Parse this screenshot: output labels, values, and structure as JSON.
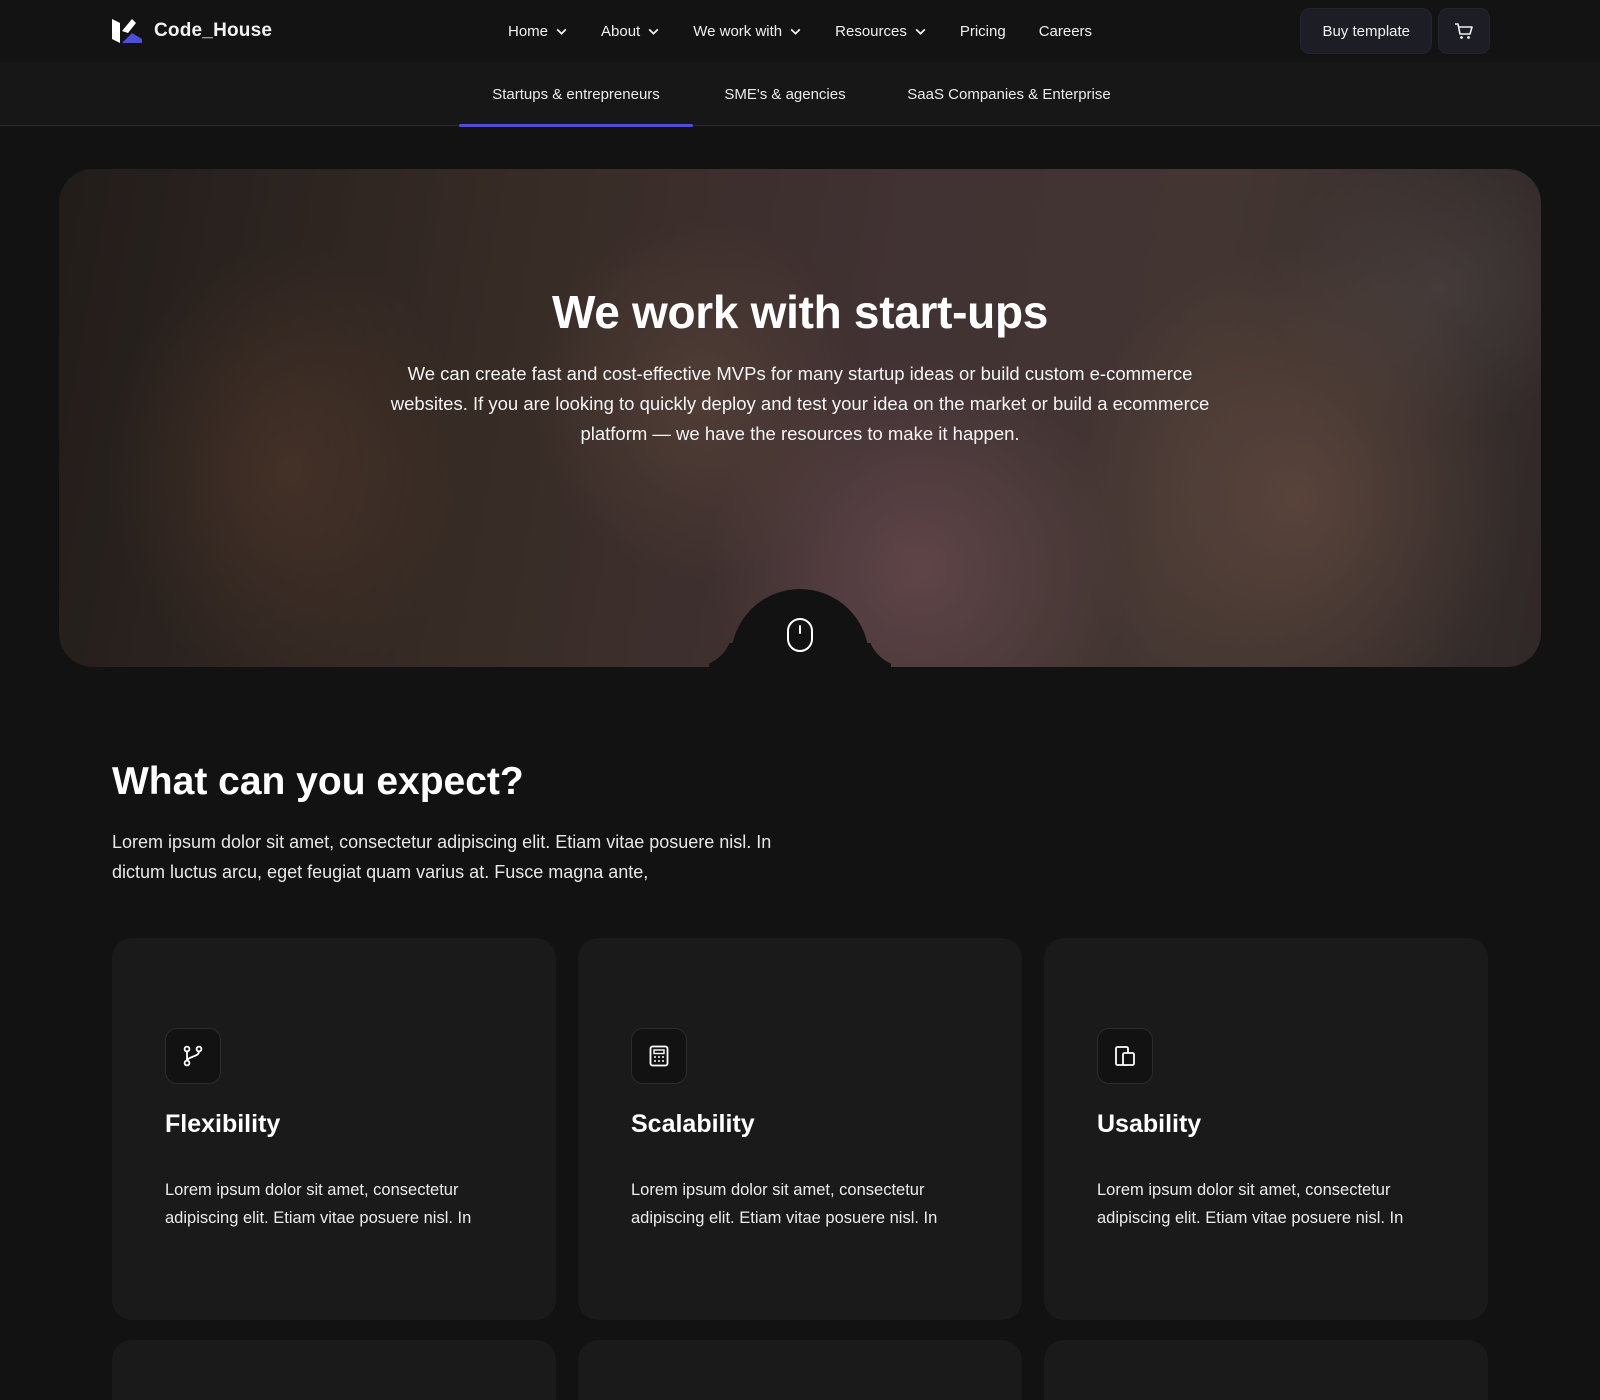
{
  "brand": {
    "name": "Code_House",
    "accent": "#4b4fd9"
  },
  "nav": {
    "items": [
      {
        "label": "Home",
        "has_dropdown": true
      },
      {
        "label": "About",
        "has_dropdown": true
      },
      {
        "label": "We work with",
        "has_dropdown": true
      },
      {
        "label": "Resources",
        "has_dropdown": true
      },
      {
        "label": "Pricing",
        "has_dropdown": false
      },
      {
        "label": "Careers",
        "has_dropdown": false
      }
    ],
    "buy_label": "Buy template",
    "cart_icon": "cart-icon"
  },
  "subnav": {
    "tabs": [
      {
        "label": "Startups & entrepreneurs",
        "active": true
      },
      {
        "label": "SME's & agencies",
        "active": false
      },
      {
        "label": "SaaS Companies & Enterprise",
        "active": false
      }
    ]
  },
  "hero": {
    "title": "We work with start-ups",
    "text": "We can create fast and cost-effective MVPs for many startup ideas or build custom e-commerce websites. If you are looking to quickly deploy and test your idea on the market or build a ecommerce platform — we have the resources to make it happen.",
    "scroll_icon": "mouse-scroll-icon"
  },
  "expect": {
    "title": "What can you expect?",
    "text": "Lorem ipsum dolor sit amet, consectetur adipiscing elit. Etiam vitae posuere nisl. In dictum luctus arcu, eget feugiat quam varius at. Fusce magna ante,",
    "cards": [
      {
        "icon": "git-branch-icon",
        "title": "Flexibility",
        "text": "Lorem ipsum dolor sit amet, consectetur adipiscing elit. Etiam vitae posuere nisl. In"
      },
      {
        "icon": "calculator-icon",
        "title": "Scalability",
        "text": "Lorem ipsum dolor sit amet, consectetur adipiscing elit. Etiam vitae posuere nisl. In"
      },
      {
        "icon": "devices-icon",
        "title": "Usability",
        "text": "Lorem ipsum dolor sit amet, consectetur adipiscing elit. Etiam vitae posuere nisl. In"
      }
    ]
  }
}
